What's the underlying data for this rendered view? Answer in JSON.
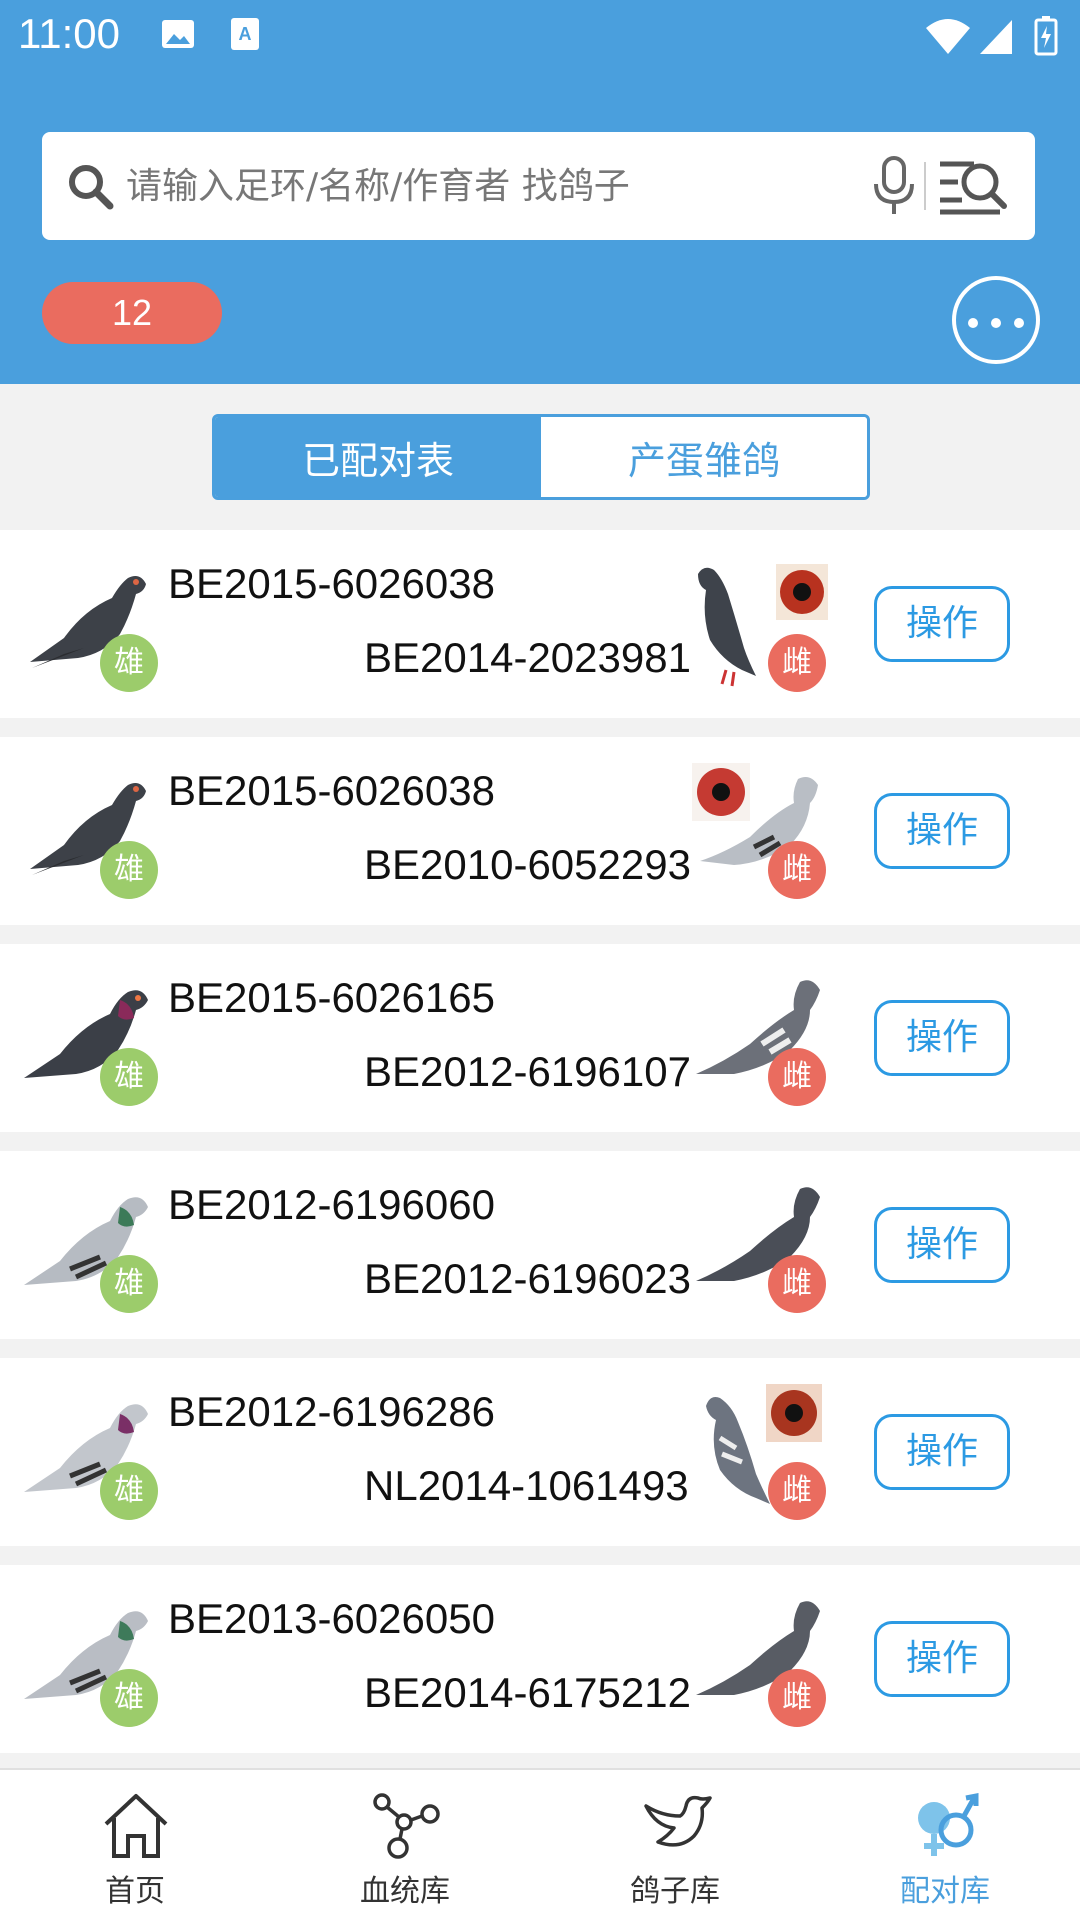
{
  "status_bar": {
    "time": "11:00"
  },
  "search": {
    "placeholder": "请输入足环/名称/作育者 找鸽子"
  },
  "count_badge": "12",
  "tabs": [
    {
      "label": "已配对表",
      "active": true
    },
    {
      "label": "产蛋雏鸽",
      "active": false
    }
  ],
  "pairs": [
    {
      "male_ring": "BE2015-6026038",
      "female_ring": "BE2014-2023981",
      "male_label": "雄",
      "female_label": "雌",
      "action": "操作"
    },
    {
      "male_ring": "BE2015-6026038",
      "female_ring": "BE2010-6052293",
      "male_label": "雄",
      "female_label": "雌",
      "action": "操作"
    },
    {
      "male_ring": "BE2015-6026165",
      "female_ring": "BE2012-6196107",
      "male_label": "雄",
      "female_label": "雌",
      "action": "操作"
    },
    {
      "male_ring": "BE2012-6196060",
      "female_ring": "BE2012-6196023",
      "male_label": "雄",
      "female_label": "雌",
      "action": "操作"
    },
    {
      "male_ring": "BE2012-6196286",
      "female_ring": "NL2014-1061493",
      "male_label": "雄",
      "female_label": "雌",
      "action": "操作"
    },
    {
      "male_ring": "BE2013-6026050",
      "female_ring": "BE2014-6175212",
      "male_label": "雄",
      "female_label": "雌",
      "action": "操作"
    }
  ],
  "bottom_nav": [
    {
      "label": "首页",
      "icon": "home-icon",
      "active": false
    },
    {
      "label": "血统库",
      "icon": "pedigree-icon",
      "active": false
    },
    {
      "label": "鸽子库",
      "icon": "bird-icon",
      "active": false
    },
    {
      "label": "配对库",
      "icon": "pairing-icon",
      "active": true
    }
  ],
  "colors": {
    "header": "#4a9fdd",
    "count_badge": "#ea6c5f",
    "male_badge": "#9ccc6b",
    "female_badge": "#ea6c5f",
    "action_button": "#2c9ae3"
  }
}
